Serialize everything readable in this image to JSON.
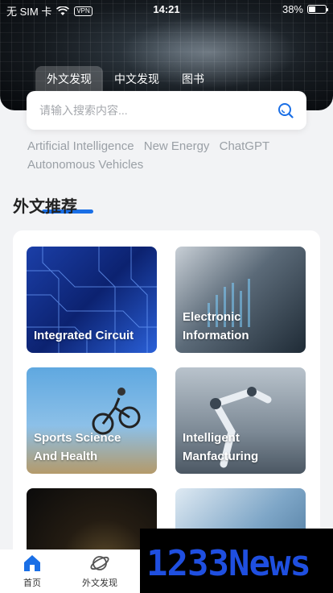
{
  "status_bar": {
    "carrier": "无 SIM 卡",
    "vpn": "VPN",
    "time": "14:21",
    "battery_percent": "38%",
    "battery_level": 0.38
  },
  "tabs": [
    {
      "label": "外文发现",
      "active": true
    },
    {
      "label": "中文发现",
      "active": false
    },
    {
      "label": "图书",
      "active": false
    }
  ],
  "search": {
    "placeholder": "请输入搜索内容..."
  },
  "hot_tags": [
    "Artificial Intelligence",
    "New Energy",
    "ChatGPT",
    "Autonomous Vehicles"
  ],
  "section": {
    "title": "外文推荐"
  },
  "cards": [
    {
      "line1": "Integrated Circuit",
      "line2": ""
    },
    {
      "line1": "Electronic",
      "line2": "Information"
    },
    {
      "line1": "Sports Science",
      "line2": "And Health"
    },
    {
      "line1": "Intelligent",
      "line2": "Manfacturing"
    },
    {
      "line1": "",
      "line2": ""
    },
    {
      "line1": "",
      "line2": ""
    }
  ],
  "bottom_nav": [
    {
      "label": "首页",
      "icon": "home-icon",
      "active": true
    },
    {
      "label": "外文发现",
      "icon": "planet-icon",
      "active": false
    }
  ],
  "watermark": "1233News",
  "colors": {
    "accent": "#1a6fe6",
    "hot_tag": "#9aa0a6",
    "background": "#f2f3f5"
  }
}
